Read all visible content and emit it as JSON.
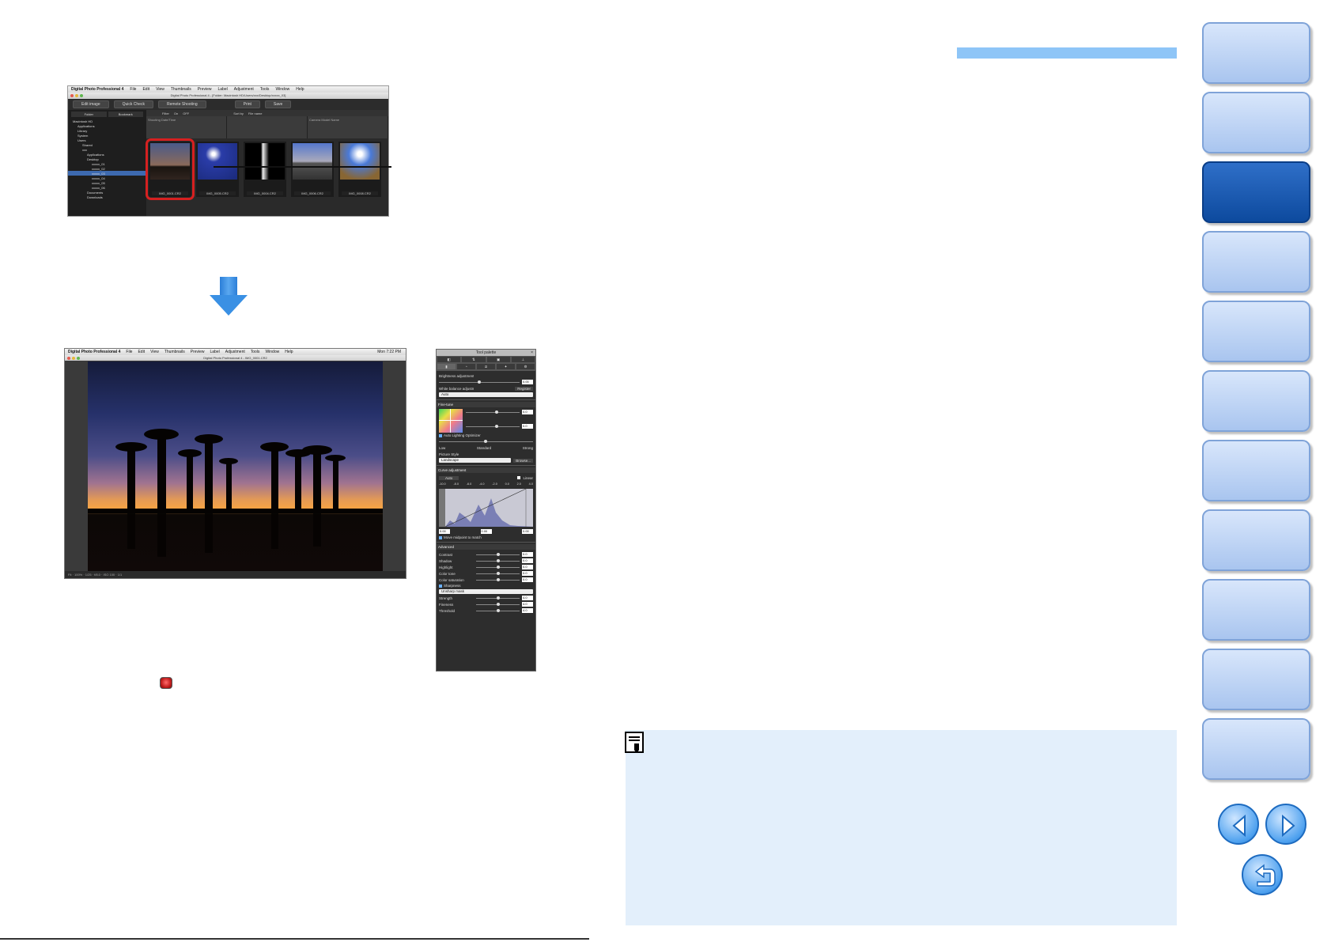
{
  "screenshot1": {
    "menubar": {
      "app": "Digital Photo Professional 4",
      "items": [
        "File",
        "Edit",
        "View",
        "Thumbnails",
        "Preview",
        "Label",
        "Adjustment",
        "Tools",
        "Window",
        "Help"
      ]
    },
    "window_title": "Digital Photo Professional 4 - [Folder: Macintosh HD/Users/xxx/Desktop/xxxxx_03]",
    "toolbar": [
      "Edit image",
      "Quick Check",
      "Remote Shooting",
      "Print",
      "Save"
    ],
    "sidebar_tabs": [
      "Folder",
      "Bookmark"
    ],
    "folder_tree": [
      "Macintosh HD",
      "Applications",
      "Library",
      "System",
      "Users",
      "Shared",
      "xxx",
      "Applications",
      "Desktop",
      "xxxxx_01",
      "xxxxx_02",
      "xxxxx_03",
      "xxxxx_04",
      "xxxxx_05",
      "xxxxx_06",
      "Documents",
      "Downloads"
    ],
    "filter_bar": [
      "Filter",
      "On",
      "OFF",
      "Sort by",
      "File name"
    ],
    "header_columns": [
      "Shooting Date/Time",
      "",
      "Camera Model Name"
    ],
    "thumbnails": [
      "IMG_0001.CR2",
      "IMG_0005.CR2",
      "IMG_0004.CR2",
      "IMG_0006.CR2",
      "IMG_0008.CR2",
      ""
    ]
  },
  "screenshot2": {
    "menubar": {
      "app": "Digital Photo Professional 4",
      "items": [
        "File",
        "Edit",
        "View",
        "Thumbnails",
        "Preview",
        "Label",
        "Adjustment",
        "Tools",
        "Window",
        "Help"
      ],
      "right": "Mon 7:22 PM"
    },
    "window_title": "Digital Photo Professional 4 - IMG_0001.CR2",
    "status": "Fit  ·  100%  ·  1/25  ·  f/8.0  ·  ISO 100  ·  1/1"
  },
  "palette": {
    "title": "Tool palette",
    "brightness": {
      "label": "Brightness adjustment",
      "value": "0.00"
    },
    "white_balance": {
      "label": "White balance adjustment",
      "register": "Register",
      "preset": "Auto"
    },
    "fine_tune": {
      "label": "Fine-tune",
      "a": "0.0",
      "g": "0.0"
    },
    "alo": {
      "label": "Auto Lighting Optimizer",
      "levels": [
        "Low",
        "Standard",
        "Strong"
      ]
    },
    "picture_style": {
      "label": "Picture Style",
      "value": "Landscape",
      "browse": "Browse..."
    },
    "curve": {
      "label": "Curve adjustment",
      "auto": "Auto",
      "linear": "Linear",
      "ticks": [
        "-10.0",
        "-8.0",
        "-6.0",
        "-4.0",
        "-2.0",
        "0.0",
        "2.0",
        "4.0"
      ],
      "values": [
        "0.00",
        "0.00",
        "0.00"
      ],
      "match": "Move midpoint to match"
    },
    "advanced": {
      "label": "Advanced",
      "rows": [
        {
          "name": "Contrast",
          "value": "0.0"
        },
        {
          "name": "Shadow",
          "value": "0.0"
        },
        {
          "name": "Highlight",
          "value": "0.0"
        },
        {
          "name": "Color tone",
          "value": "0.0"
        },
        {
          "name": "Color saturation",
          "value": "0.0"
        }
      ]
    },
    "sharpness": {
      "label": "Sharpness",
      "mode": "Unsharp mask",
      "rows": [
        {
          "name": "Strength",
          "value": "4.0"
        },
        {
          "name": "Fineness",
          "value": "4.0"
        },
        {
          "name": "Threshold",
          "value": "4.0"
        }
      ]
    }
  },
  "colors": {
    "accent_blue": "#3a90e4",
    "selection_red": "#d62020",
    "note_bg": "#e3effb",
    "banner": "#8ec5f7",
    "tab_active": "#0d4a9e"
  },
  "nav": {
    "tabs": [
      "",
      "",
      "",
      "",
      "",
      "",
      "",
      "",
      "",
      "",
      ""
    ],
    "active_index": 2,
    "buttons": [
      "prev-page-icon",
      "next-page-icon",
      "return-icon"
    ]
  }
}
